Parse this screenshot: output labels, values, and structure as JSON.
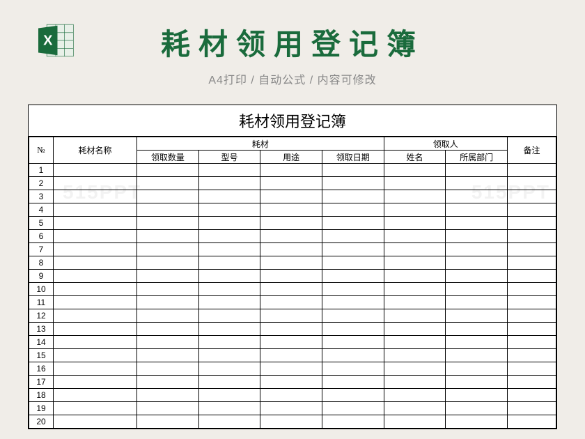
{
  "header": {
    "title": "耗材领用登记簿",
    "subtitle": "A4打印 / 自动公式 / 内容可修改"
  },
  "sheet": {
    "title": "耗材领用登记簿",
    "columns": {
      "no": "№",
      "name": "耗材名称",
      "consumable_group": "耗材",
      "qty": "领取数量",
      "model": "型号",
      "purpose": "用途",
      "date": "领取日期",
      "recipient_group": "领取人",
      "recipient_name": "姓名",
      "department": "所属部门",
      "remark": "备注"
    },
    "row_count": 20
  },
  "watermark": "515PPT"
}
